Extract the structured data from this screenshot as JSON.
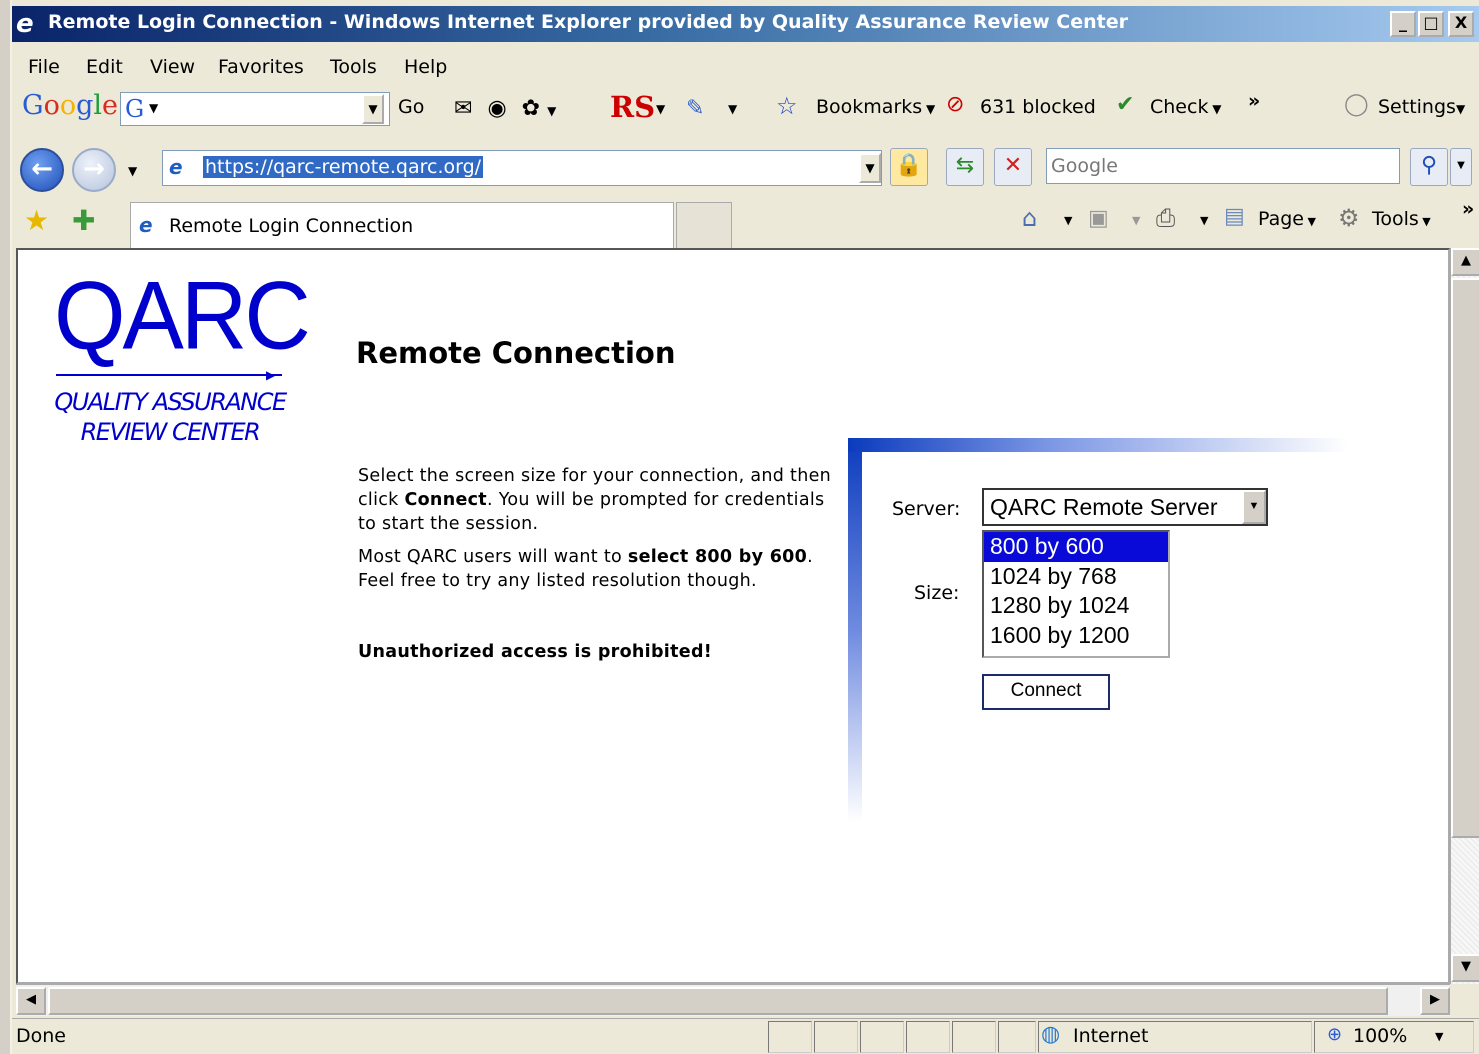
{
  "window": {
    "title": "Remote Login Connection - Windows Internet Explorer provided by Quality Assurance Review Center",
    "minimize": "_",
    "maximize": "□",
    "close": "X"
  },
  "menu": [
    "File",
    "Edit",
    "View",
    "Favorites",
    "Tools",
    "Help"
  ],
  "google_toolbar": {
    "logo": "Google",
    "go_label": "Go",
    "rs_label": "RS",
    "bookmarks_label": "Bookmarks",
    "blocked_label": "631 blocked",
    "check_label": "Check",
    "more": "»",
    "settings_label": "Settings"
  },
  "address": {
    "url": "https://qarc-remote.qarc.org/",
    "search_placeholder": "Google"
  },
  "tabs": {
    "active_label": "Remote Login Connection",
    "page_menu": "Page",
    "tools_menu": "Tools",
    "more": "»"
  },
  "page": {
    "logo_big": "QARC",
    "logo_line1": "QUALITY ASSURANCE",
    "logo_line2": "REVIEW CENTER",
    "heading": "Remote Connection",
    "para1_a": "Select the screen size for your connection, and then click ",
    "para1_b": "Connect",
    "para1_c": ". You will be prompted for credentials to start the session.",
    "para2_a": "Most QARC users will want to ",
    "para2_b": "select 800 by 600",
    "para2_c": ". Feel free to try any listed resolution though.",
    "warning": "Unauthorized access is prohibited!",
    "server_label": "Server:",
    "server_value": "QARC Remote Server",
    "size_label": "Size:",
    "sizes": [
      "800 by 600",
      "1024 by 768",
      "1280 by 1024",
      "1600 by 1200"
    ],
    "selected_size": "800 by 600",
    "connect_label": "Connect"
  },
  "status": {
    "text": "Done",
    "zone": "Internet",
    "zoom": "100%"
  }
}
